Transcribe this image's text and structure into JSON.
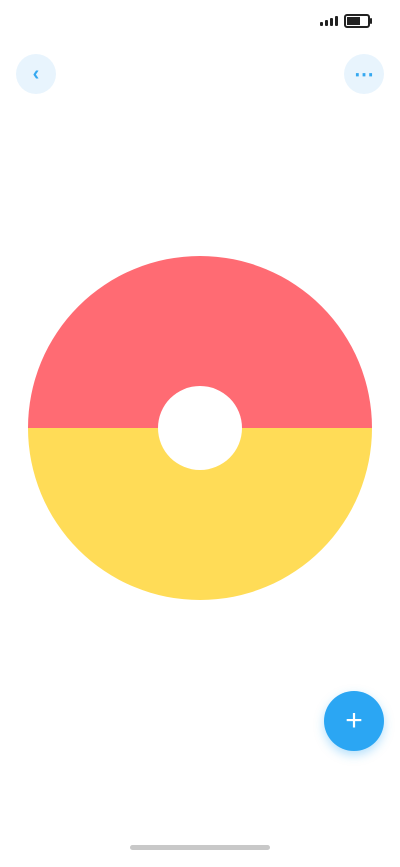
{
  "status_bar": {
    "time": "",
    "battery_level": 0.8
  },
  "nav": {
    "left_icon": "back-icon",
    "title": "",
    "right_link": "",
    "right_icon": "more-icon"
  },
  "chart_data": {
    "type": "pie",
    "title": "",
    "slices": [
      {
        "label": "",
        "value": 50,
        "color": "#ff6b73"
      },
      {
        "label": "",
        "value": 50,
        "color": "#ffdc57"
      }
    ],
    "center_label": "",
    "hole": true
  },
  "fab": {
    "icon": "add-icon",
    "color": "#2ba6f3"
  }
}
